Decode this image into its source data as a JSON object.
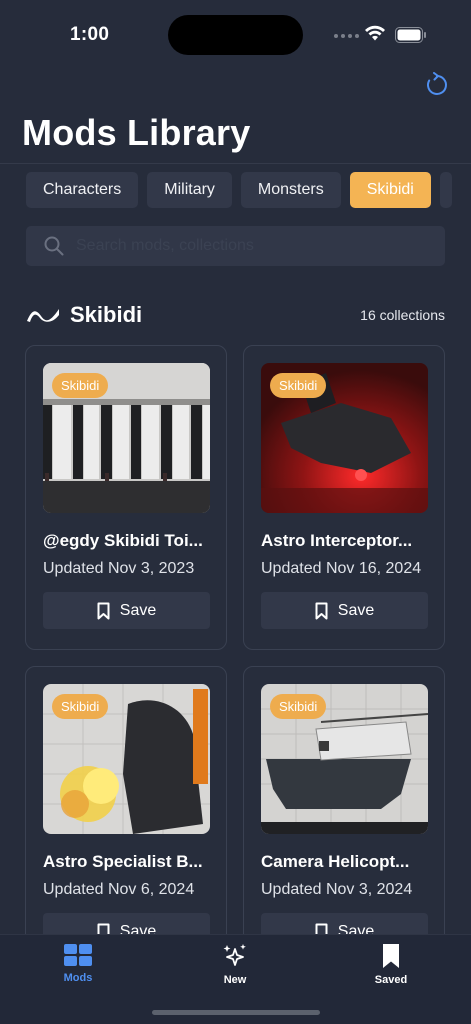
{
  "status": {
    "time": "1:00"
  },
  "page": {
    "title": "Mods Library"
  },
  "tabs": [
    {
      "label": "Characters"
    },
    {
      "label": "Military"
    },
    {
      "label": "Monsters"
    },
    {
      "label": "Skibidi",
      "active": true
    }
  ],
  "search": {
    "placeholder": "Search mods, collections"
  },
  "section": {
    "title": "Skibidi",
    "count": "16 collections",
    "icon": "wave-icon"
  },
  "cards": [
    {
      "tag": "Skibidi",
      "title": "@egdy Skibidi Toi...",
      "date": "Updated Nov 3, 2023",
      "save_label": "Save"
    },
    {
      "tag": "Skibidi",
      "title": "Astro Interceptor...",
      "date": "Updated Nov 16, 2024",
      "save_label": "Save"
    },
    {
      "tag": "Skibidi",
      "title": "Astro Specialist B...",
      "date": "Updated Nov 6, 2024",
      "save_label": "Save"
    },
    {
      "tag": "Skibidi",
      "title": "Camera Helicopt...",
      "date": "Updated Nov 3, 2024",
      "save_label": "Save"
    }
  ],
  "tabbar": {
    "items": [
      {
        "label": "Mods",
        "icon": "grid-icon",
        "active": true
      },
      {
        "label": "New",
        "icon": "sparkles-icon"
      },
      {
        "label": "Saved",
        "icon": "bookmark-icon"
      }
    ]
  },
  "colors": {
    "accent": "#f4b454",
    "active_tab": "#4f8ff0",
    "background": "#262c3b"
  }
}
